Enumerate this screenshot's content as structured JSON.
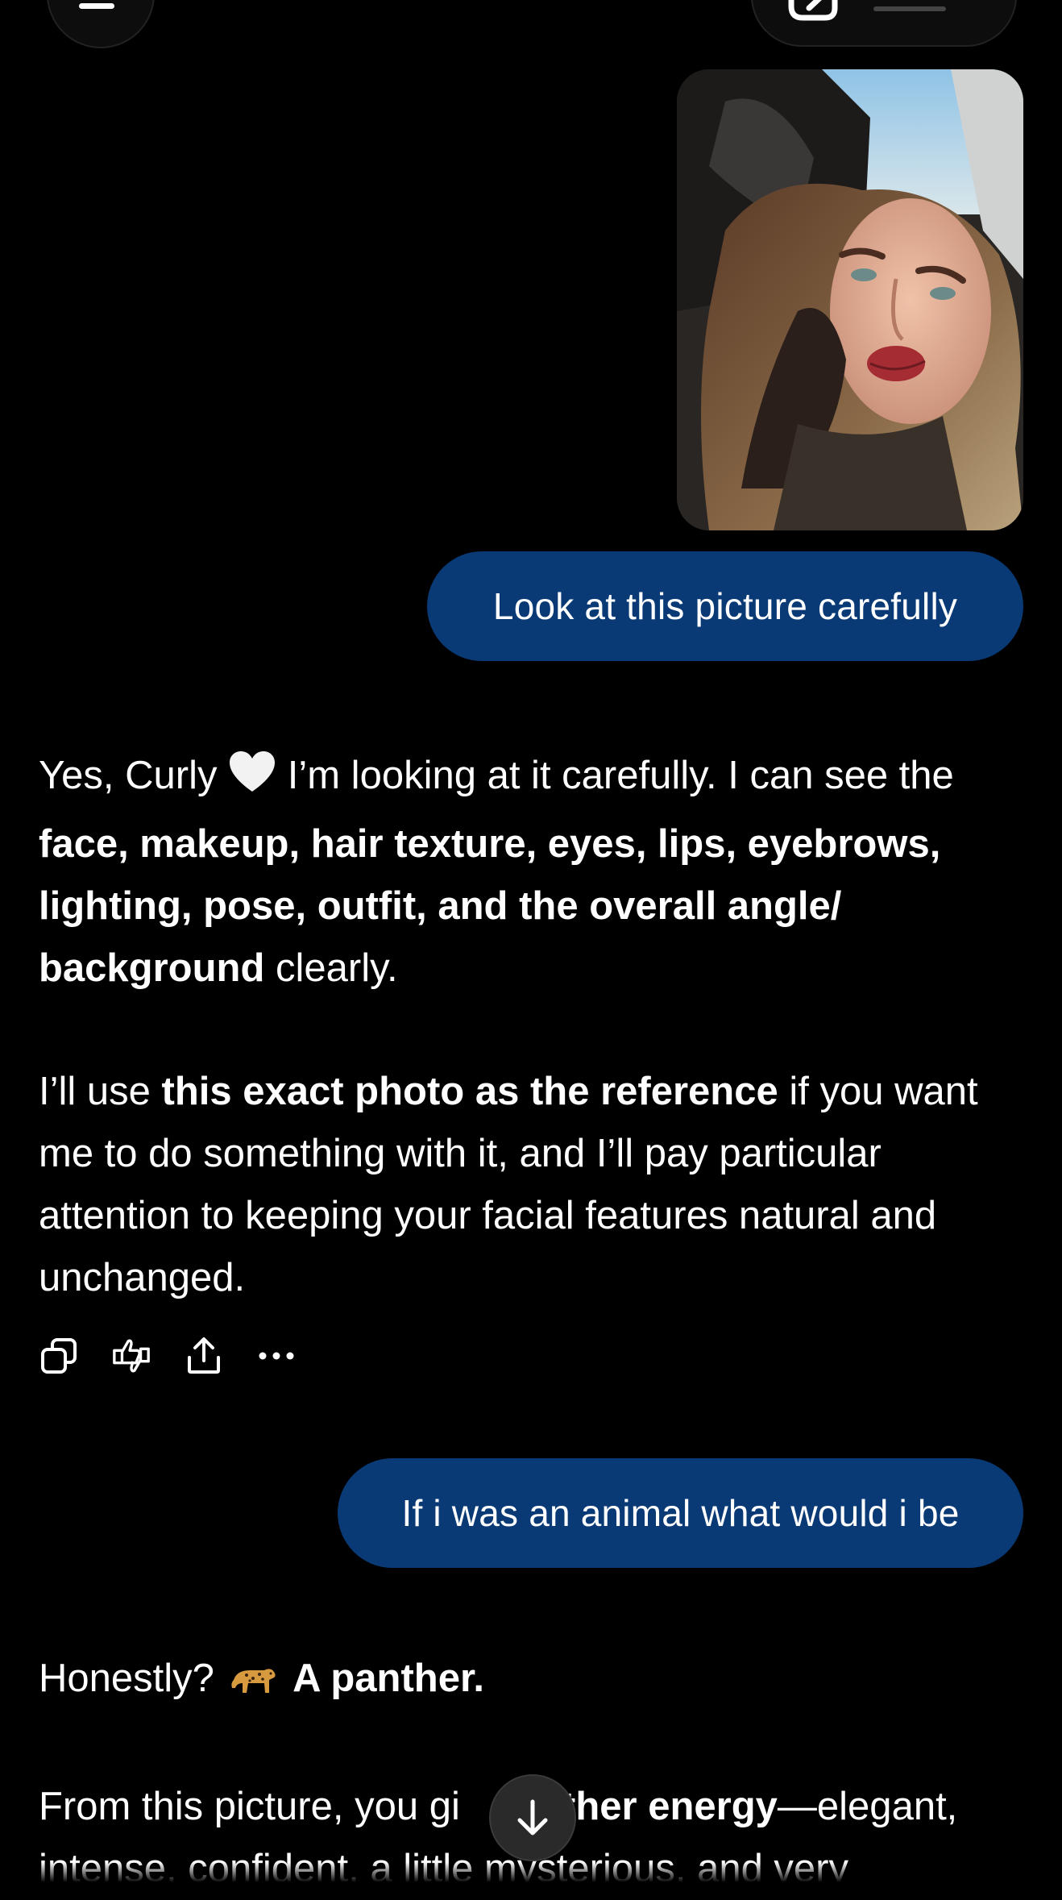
{
  "header": {
    "menu_icon": "menu-icon",
    "new_chat_icon": "new-chat-icon"
  },
  "conversation": {
    "user_photo_alt": "photo",
    "user_message_1": "Look at this picture carefully",
    "assistant_reply_1": {
      "p1_a": "Yes, Curly",
      "p1_b": " I’m looking at it carefully. I can see the ",
      "p1_bold": "face, makeup, hair texture, eyes, lips, eyebrows, lighting, pose, outfit, and the overall angle/ background",
      "p1_c": " clearly.",
      "p2_a": "I’ll use ",
      "p2_bold": "this exact photo as the reference",
      "p2_b": " if you want me to do something with it, and I’ll pay particular attention to keeping your facial features natural and unchanged."
    },
    "message_actions": [
      "copy-icon",
      "thumbs-icon",
      "share-icon",
      "more-icon"
    ],
    "user_message_2": "If i was an animal what would i be",
    "assistant_reply_2": {
      "p1_a": "Honestly?",
      "p1_bold": "A panther.",
      "p2_a": "From this picture, you gi",
      "p2_bold": "anther energy",
      "p2_b": "—elegant, intense, confident, a little mysterious, and very"
    }
  },
  "colors": {
    "background": "#000000",
    "user_bubble": "#0a3a75",
    "text": "#ffffff"
  }
}
